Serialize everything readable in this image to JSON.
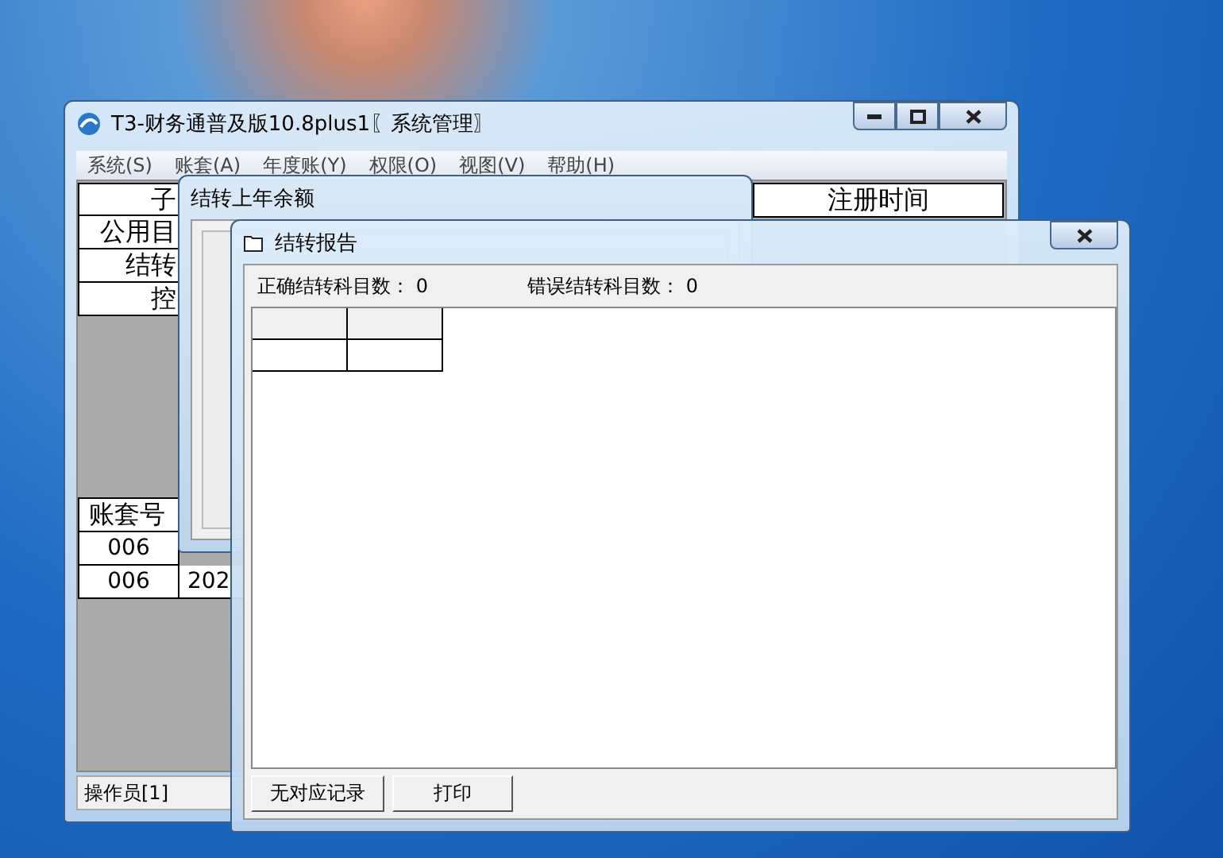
{
  "main_window": {
    "title": "T3-财务通普及版10.8plus1〖系统管理〗",
    "menu": [
      "系统(S)",
      "账套(A)",
      "年度账(Y)",
      "权限(O)",
      "视图(V)",
      "帮助(H)"
    ],
    "top_table": {
      "rows": [
        "子",
        "公用目",
        "结转",
        "控"
      ],
      "column_header": "注册时间"
    },
    "account_table": {
      "header": "账套号",
      "rows": [
        {
          "column_1": "006"
        },
        {
          "column_1": "006",
          "column_2": "202"
        }
      ]
    },
    "status_bar": "操作员[1]"
  },
  "carryover_window": {
    "title": "结转上年余额"
  },
  "report_window": {
    "title": "结转报告",
    "stats": [
      {
        "label": "正确结转科目数：",
        "value": "0"
      },
      {
        "label": "错误结转科目数：",
        "value": "0"
      }
    ],
    "buttons": [
      "无对应记录",
      "打印"
    ]
  }
}
